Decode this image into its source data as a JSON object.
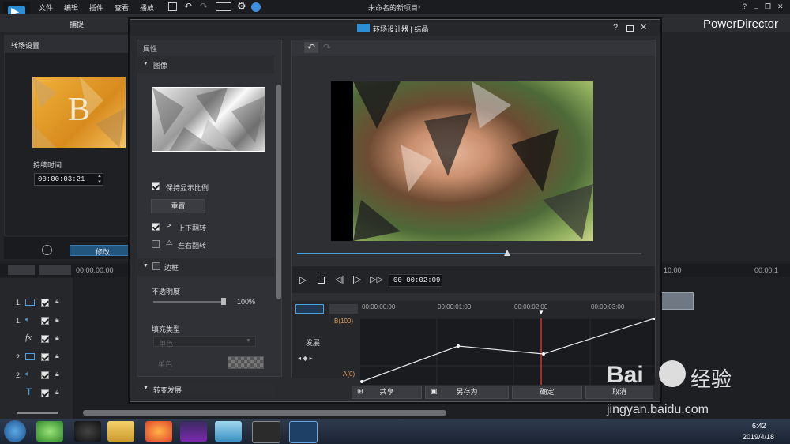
{
  "app": {
    "title": "未命名的新项目*",
    "brand": "PowerDirector",
    "menu": [
      "文件",
      "编辑",
      "插件",
      "查看",
      "播放"
    ],
    "capture_tab": "捕捉",
    "help": "?",
    "window_controls": {
      "minimize": "_",
      "restore": "❐",
      "close": "✕"
    }
  },
  "left_panel": {
    "title": "转场设置",
    "duration_label": "持续时间",
    "duration_value": "00:00:03:21",
    "thumb_letter": "B",
    "modify_button": "修改"
  },
  "dialog": {
    "title": "转场设计器 | 结晶",
    "help": "?",
    "properties_label": "属性",
    "image_section": "图像",
    "keep_ratio": "保持显示比例",
    "keep_ratio_checked": true,
    "reset_button": "重置",
    "flip_vertical": "上下翻转",
    "flip_vertical_checked": true,
    "flip_horizontal": "左右翻转",
    "flip_horizontal_checked": false,
    "border_section": "边框",
    "opacity_label": "不透明度",
    "opacity_value": "100%",
    "opacity_fraction": 1.0,
    "fill_type_label": "填充类型",
    "fill_type_value": "单色",
    "fill_color_label": "单色",
    "transition_progress_section": "转变发展",
    "timecode": "00:00:02:09",
    "playhead_fraction": 0.71,
    "keyframe_ruler": [
      "00:00:00:00",
      "00:00:01:00",
      "00:00:02:00",
      "00:00:03:00"
    ],
    "keyframe_label": "发展",
    "b_label": "B(100)",
    "a_label": "A(0)",
    "buttons": {
      "share": "共享",
      "save_as": "另存为",
      "ok": "确定",
      "cancel": "取消"
    }
  },
  "timeline": {
    "ruler_start": "00:00:00:00",
    "ruler_right1": "10:00",
    "ruler_right2": "00:00:1",
    "tracks": [
      {
        "num": "1.",
        "type": "video"
      },
      {
        "num": "1.",
        "type": "audio"
      },
      {
        "num": "",
        "type": "fx"
      },
      {
        "num": "2.",
        "type": "video"
      },
      {
        "num": "2.",
        "type": "audio"
      },
      {
        "num": "",
        "type": "title"
      },
      {
        "num": "",
        "type": "voice"
      }
    ]
  },
  "taskbar": {
    "time": "6:42",
    "date": "2019/4/18"
  },
  "watermark": {
    "brand": "Bai",
    "cn": "经验",
    "url": "jingyan.baidu.com"
  },
  "colors": {
    "accent": "#4aa3e0",
    "playhead": "#d83030",
    "curve": "#e6e6e6"
  }
}
